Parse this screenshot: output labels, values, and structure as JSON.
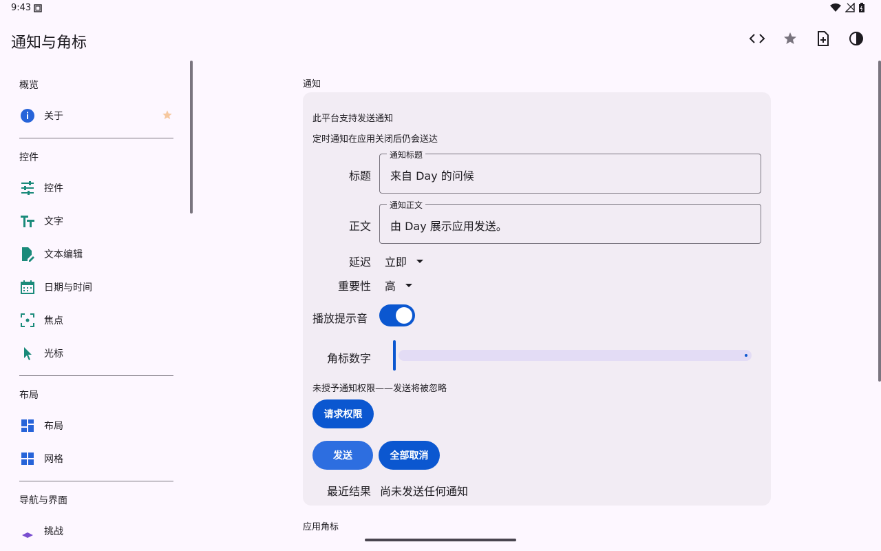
{
  "status": {
    "time": "9:43"
  },
  "appbar": {
    "title": "通知与角标"
  },
  "sidebar": {
    "sections": {
      "overview": "概览",
      "controls": "控件",
      "layout": "布局",
      "navigation": "导航与界面"
    },
    "items": {
      "about": "关于",
      "controls": "控件",
      "text": "文字",
      "text_edit": "文本编辑",
      "date_time": "日期与时间",
      "focus": "焦点",
      "cursor": "光标",
      "layout": "布局",
      "grid": "网格",
      "partial": "挑战"
    }
  },
  "main": {
    "notification_group": "通知",
    "badge_group": "应用角标",
    "card": {
      "supported": "此平台支持发送通知",
      "scheduled_note": "定时通知在应用关闭后仍会送达",
      "title_label": "标题",
      "title_legend": "通知标题",
      "title_value": "来自 Day 的问候",
      "body_label": "正文",
      "body_legend": "通知正文",
      "body_value": "由 Day 展示应用发送。",
      "delay_label": "延迟",
      "delay_value": "立即",
      "importance_label": "重要性",
      "importance_value": "高",
      "sound_label": "播放提示音",
      "sound_on": true,
      "badge_label": "角标数字",
      "badge_level": 0,
      "permission_note": "未授予通知权限——发送将被忽略",
      "request_permission": "请求权限",
      "send": "发送",
      "cancel_all": "全部取消",
      "result_label": "最近结果",
      "result_value": "尚未发送任何通知"
    }
  },
  "colors": {
    "background": "#fdf7ff",
    "card": "#f2ecf4",
    "primary": "#0b57d0",
    "icon_teal": "#1a8a7a",
    "icon_blue": "#2764d9",
    "star": "#f6c8a0"
  }
}
